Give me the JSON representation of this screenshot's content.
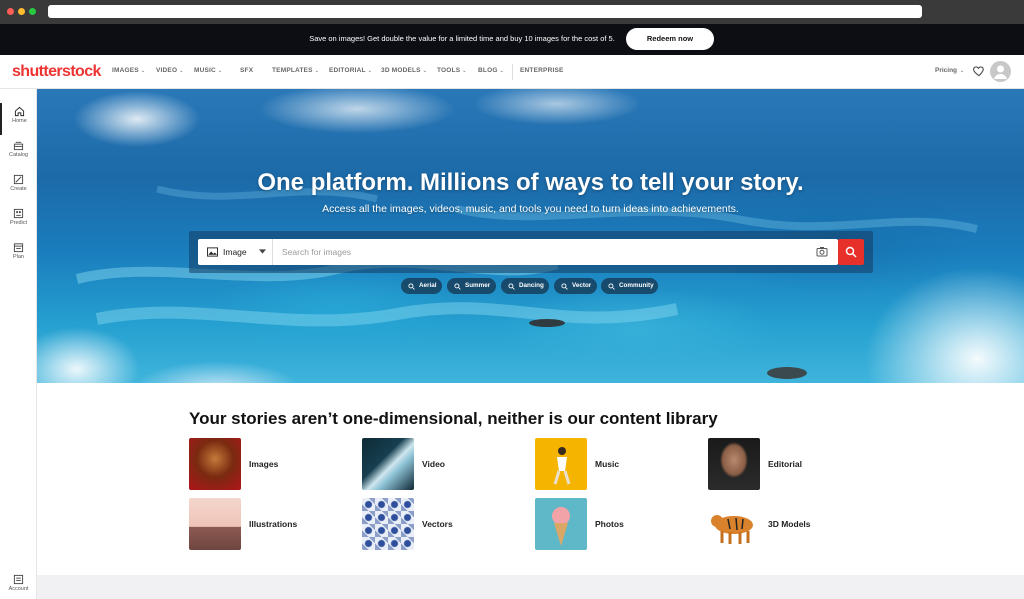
{
  "promo": {
    "text": "Save on images! Get double the value for a limited time and buy 10 images for the cost of 5.",
    "cta": "Redeem now"
  },
  "nav": {
    "logo": "shutterstock",
    "items": [
      {
        "label": "IMAGES",
        "dropdown": true
      },
      {
        "label": "VIDEO",
        "dropdown": true
      },
      {
        "label": "MUSIC",
        "dropdown": true
      },
      {
        "label": "SFX",
        "dropdown": false
      },
      {
        "label": "TEMPLATES",
        "dropdown": true
      },
      {
        "label": "EDITORIAL",
        "dropdown": true
      },
      {
        "label": "3D MODELS",
        "dropdown": true
      },
      {
        "label": "TOOLS",
        "dropdown": true
      },
      {
        "label": "BLOG",
        "dropdown": true
      },
      {
        "label": "ENTERPRISE",
        "dropdown": false
      }
    ],
    "pricing": "Pricing"
  },
  "sidebar": {
    "items": [
      {
        "label": "Home",
        "icon": "home-icon"
      },
      {
        "label": "Catalog",
        "icon": "catalog-icon"
      },
      {
        "label": "Create",
        "icon": "create-icon"
      },
      {
        "label": "Predict",
        "icon": "predict-icon"
      },
      {
        "label": "Plan",
        "icon": "plan-icon"
      }
    ],
    "account": "Account"
  },
  "hero": {
    "title": "One platform. Millions of ways to tell your story.",
    "subtitle": "Access all the images, videos, music, and tools you need to turn ideas into achievements.",
    "search": {
      "type": "Image",
      "placeholder": "Search for images",
      "value": ""
    },
    "chips": [
      "Aerial",
      "Summer",
      "Dancing",
      "Vector",
      "Community"
    ]
  },
  "library": {
    "title": "Your stories aren’t one-dimensional, neither is our content library",
    "tiles": [
      {
        "label": "Images"
      },
      {
        "label": "Video"
      },
      {
        "label": "Music"
      },
      {
        "label": "Editorial"
      },
      {
        "label": "Illustrations"
      },
      {
        "label": "Vectors"
      },
      {
        "label": "Photos"
      },
      {
        "label": "3D Models"
      }
    ]
  },
  "colors": {
    "brand": "#e33333",
    "search_button": "#e8302a",
    "promo_bg": "#0d0d14"
  }
}
